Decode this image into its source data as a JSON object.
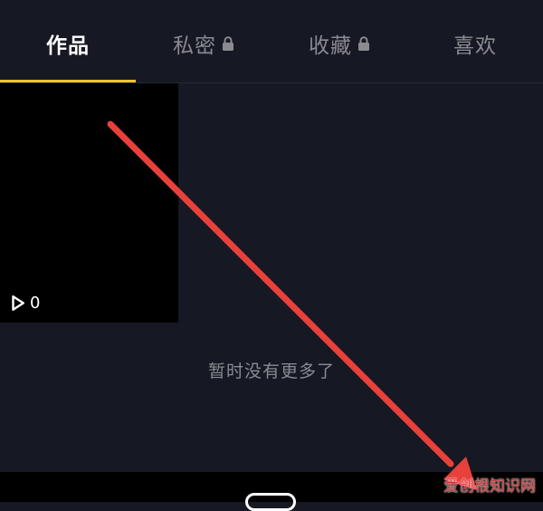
{
  "tabs": [
    {
      "label": "作品",
      "active": true,
      "locked": false
    },
    {
      "label": "私密",
      "active": false,
      "locked": true
    },
    {
      "label": "收藏",
      "active": false,
      "locked": true
    },
    {
      "label": "喜欢",
      "active": false,
      "locked": false
    }
  ],
  "video": {
    "play_count": "0"
  },
  "empty_state": {
    "text": "暂时没有更多了"
  },
  "watermark": {
    "text": "爱创根知识网"
  },
  "colors": {
    "background": "#161823",
    "accent_underline": "#f5c52a",
    "annotation_arrow": "#e8413b"
  },
  "icons": {
    "lock": "lock-icon",
    "play": "play-icon"
  }
}
